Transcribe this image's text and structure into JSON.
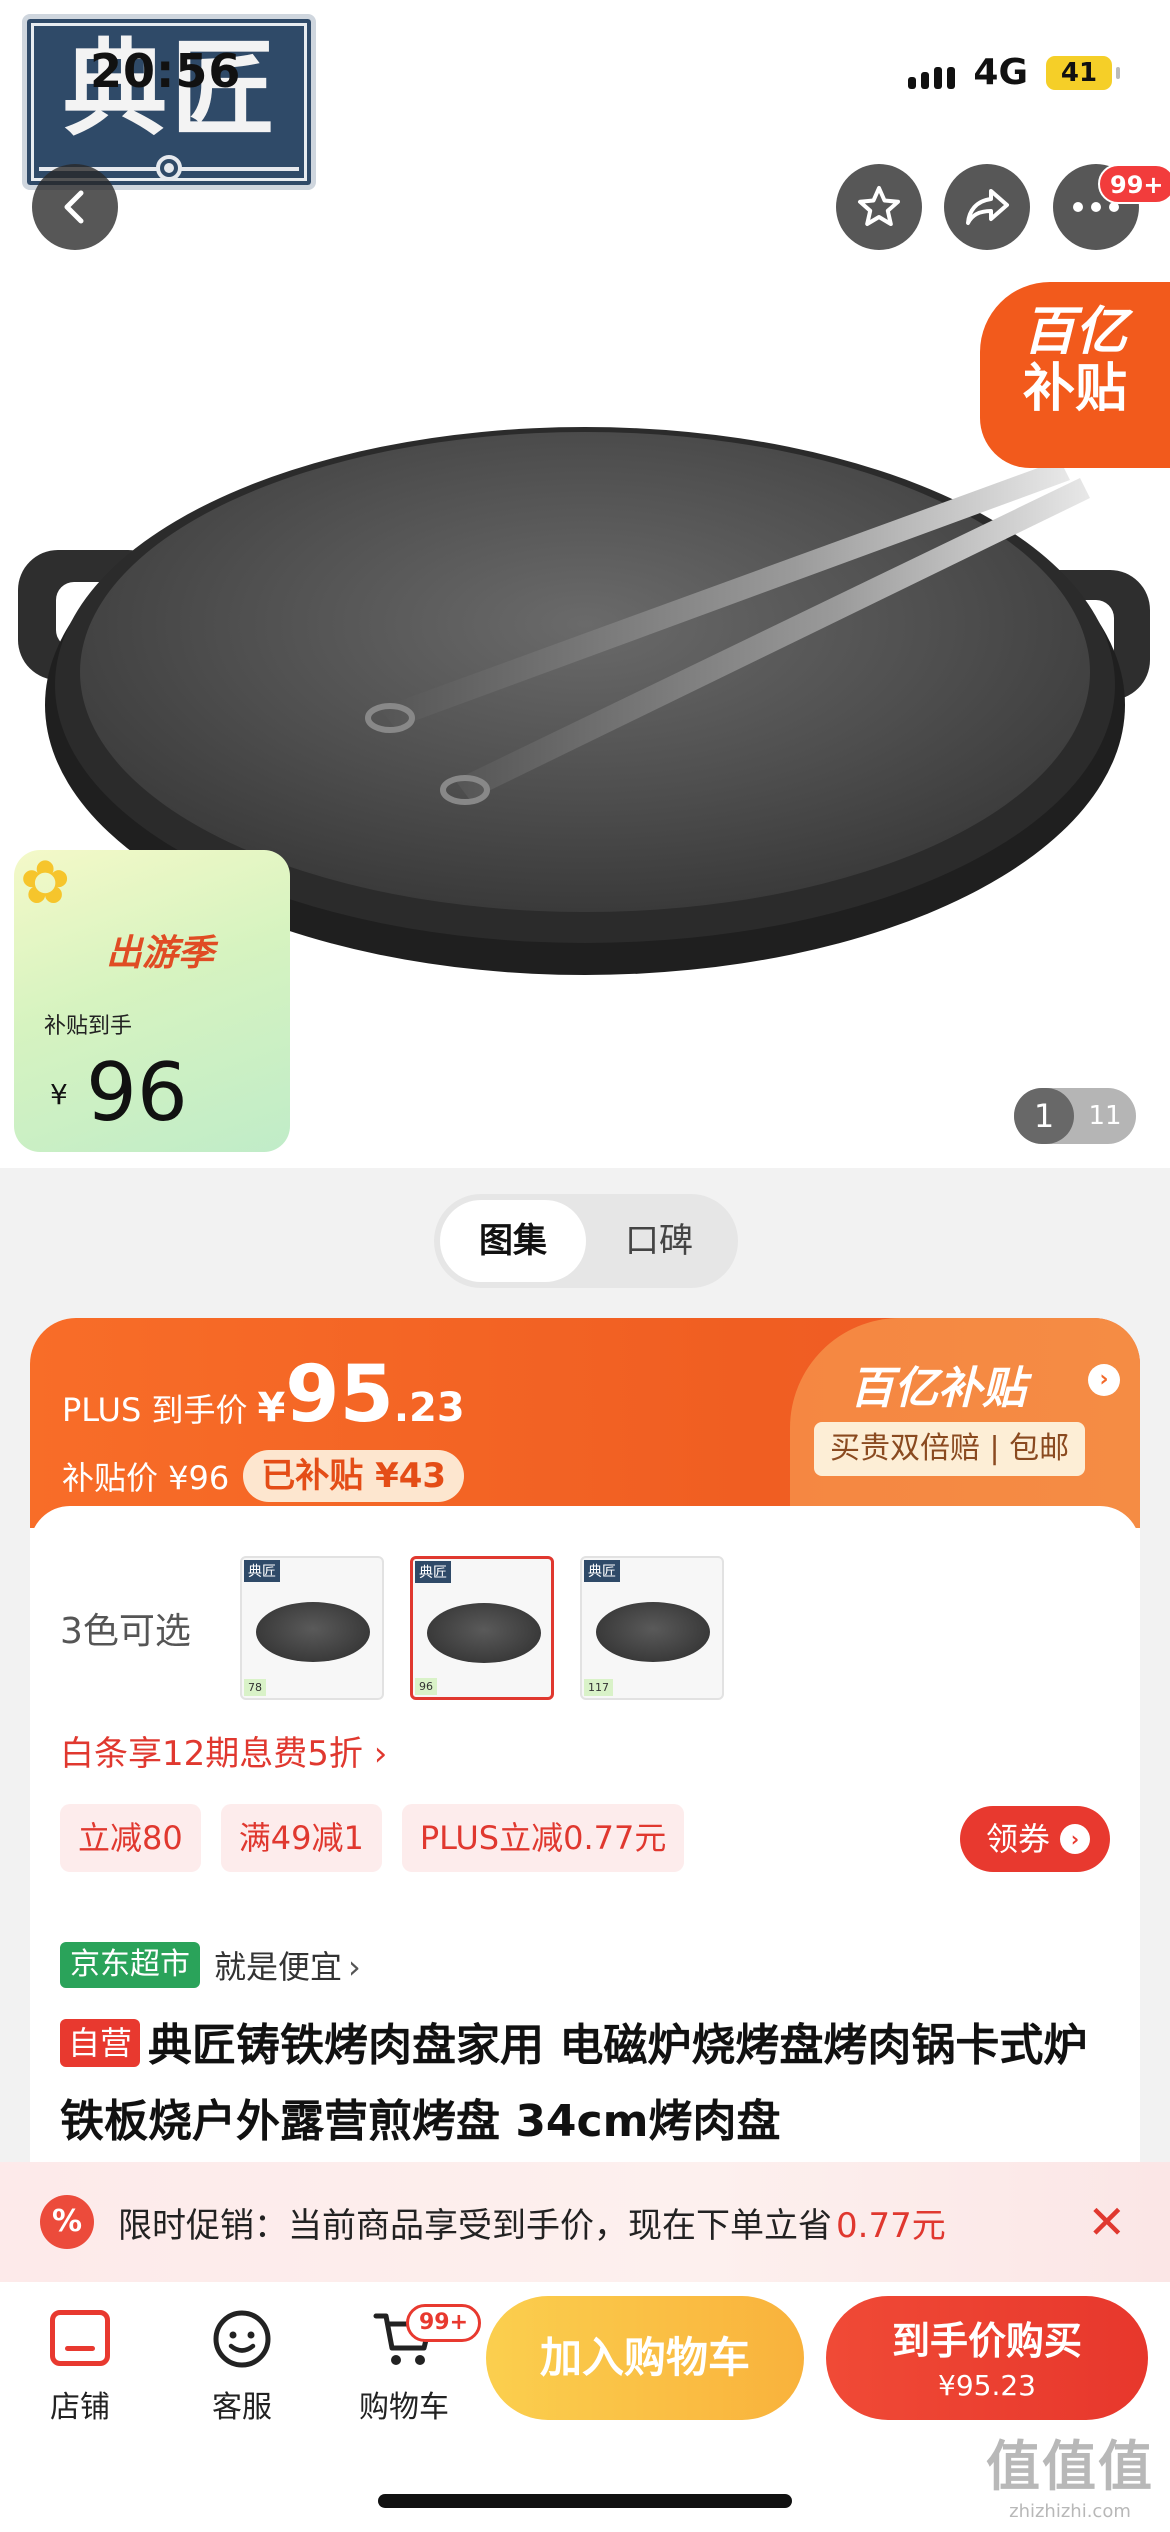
{
  "status_bar": {
    "time": "20:56",
    "network": "4G",
    "battery": "41"
  },
  "brand": {
    "logo_text": "典匠"
  },
  "header": {
    "back_icon": "chevron-left-icon",
    "favorite_icon": "star-icon",
    "share_icon": "share-arrow-icon",
    "more_icon": "more-dots-icon",
    "more_badge": "99+"
  },
  "hero": {
    "subsidy_corner": {
      "line1": "百亿",
      "line2": "补贴"
    },
    "promo_sticker": {
      "title": "出游季",
      "label": "补贴到手",
      "currency": "¥",
      "price": "96"
    },
    "pager": {
      "current": "1",
      "total": "11"
    }
  },
  "gallery_tabs": [
    {
      "label": "图集",
      "active": true
    },
    {
      "label": "口碑",
      "active": false
    }
  ],
  "price_card": {
    "plus_label": "PLUS 到手价",
    "plus_currency": "¥",
    "plus_integer": "95",
    "plus_decimal": ".23",
    "subsidy_price_label": "补贴价 ¥96",
    "subsidized_chip": "已补贴 ¥43",
    "campaign_title": "百亿补贴",
    "guarantee": "买贵双倍赔 | 包邮",
    "colors_label": "3色可选",
    "swatches": [
      {
        "tag": "典匠",
        "price": "78",
        "selected": false
      },
      {
        "tag": "典匠",
        "price": "96",
        "selected": true
      },
      {
        "tag": "典匠",
        "price": "117",
        "selected": false
      }
    ],
    "installment": "白条享12期息费5折 ›",
    "coupons": [
      "立减80",
      "满49减1",
      "PLUS立减0.77元"
    ],
    "get_coupon": "领券",
    "market_tag": "京东超市",
    "market_slogan": "就是便宜",
    "self_operated_tag": "自营",
    "product_title": "典匠铸铁烤肉盘家用 电磁炉烧烤盘烤肉锅卡式炉铁板烧户外露营煎烤盘 34cm烤肉盘"
  },
  "promo_banner": {
    "icon": "percent-icon",
    "text": "限时促销：当前商品享受到手价，现在下单立省",
    "amount": "0.77元",
    "close_icon": "close-icon"
  },
  "bottom_bar": {
    "shop": "店铺",
    "service": "客服",
    "cart": "购物车",
    "cart_badge": "99+",
    "add_to_cart": "加入购物车",
    "buy_now": "到手价购买",
    "buy_price": "¥95.23"
  },
  "watermark": {
    "logo": "值值值",
    "url": "zhizhizhi.com"
  },
  "colors": {
    "accent_red": "#e8392f",
    "subsidy_orange": "#f05e22",
    "cart_yellow": "#f9b23c"
  }
}
